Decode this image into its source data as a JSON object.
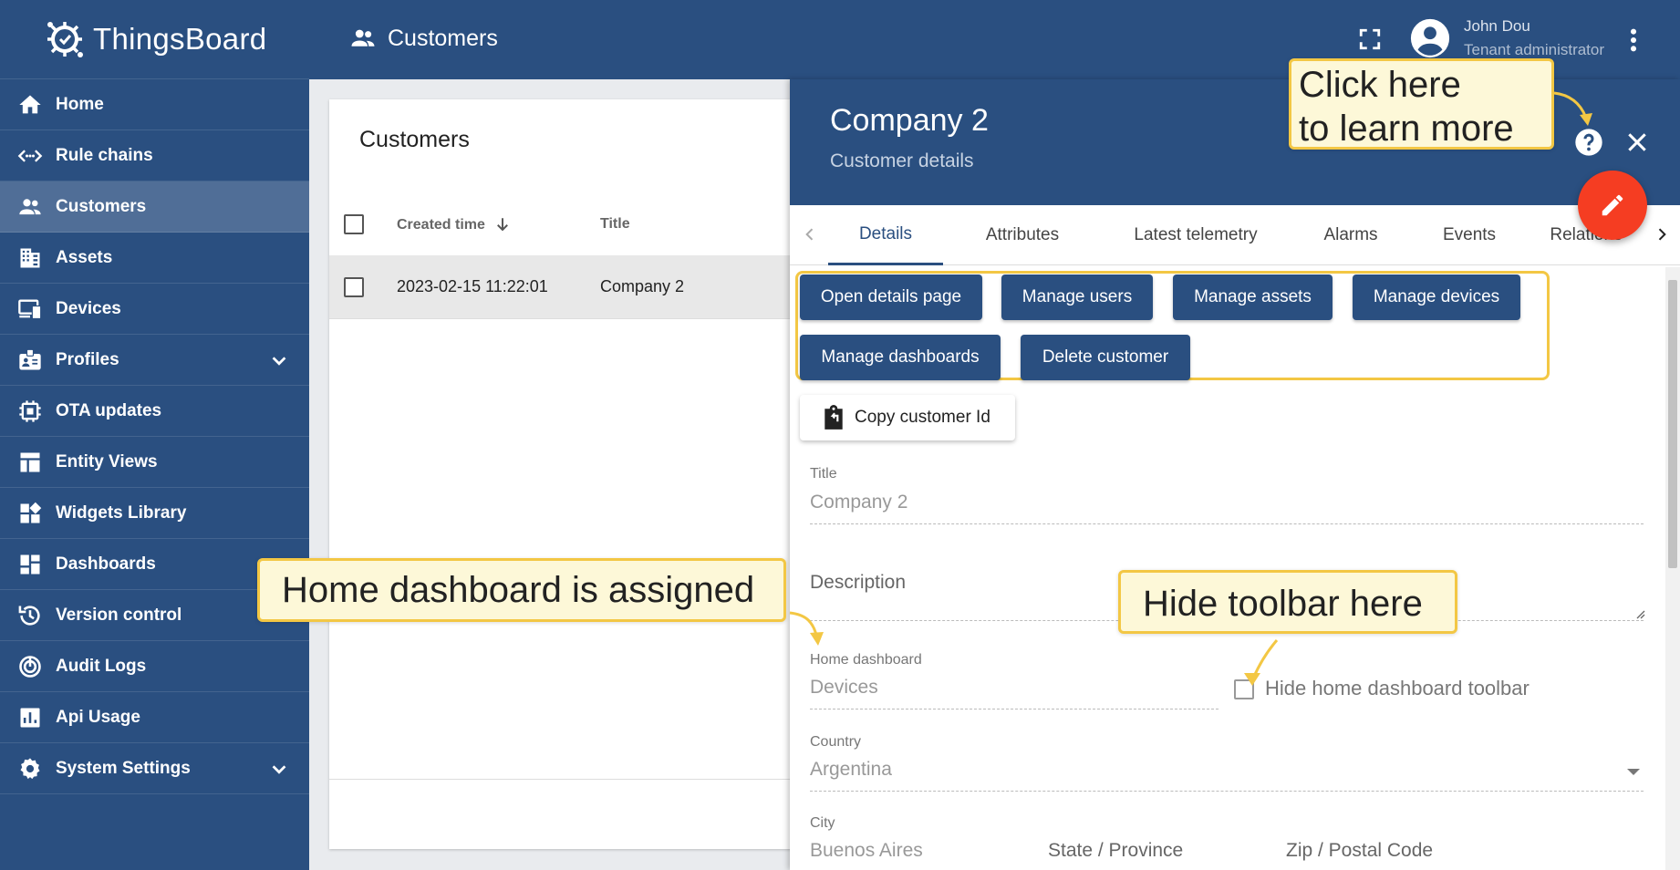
{
  "app": {
    "name": "ThingsBoard"
  },
  "sidebar": {
    "items": [
      {
        "label": "Home",
        "icon": "home-icon"
      },
      {
        "label": "Rule chains",
        "icon": "rule-chains-icon"
      },
      {
        "label": "Customers",
        "icon": "customers-icon",
        "active": true
      },
      {
        "label": "Assets",
        "icon": "assets-icon"
      },
      {
        "label": "Devices",
        "icon": "devices-icon"
      },
      {
        "label": "Profiles",
        "icon": "profiles-icon",
        "expandable": true
      },
      {
        "label": "OTA updates",
        "icon": "ota-updates-icon"
      },
      {
        "label": "Entity Views",
        "icon": "entity-views-icon"
      },
      {
        "label": "Widgets Library",
        "icon": "widgets-library-icon"
      },
      {
        "label": "Dashboards",
        "icon": "dashboards-icon"
      },
      {
        "label": "Version control",
        "icon": "version-control-icon"
      },
      {
        "label": "Audit Logs",
        "icon": "audit-logs-icon"
      },
      {
        "label": "Api Usage",
        "icon": "api-usage-icon"
      },
      {
        "label": "System Settings",
        "icon": "system-settings-icon",
        "expandable": true
      }
    ]
  },
  "topbar": {
    "title": "Customers",
    "user": {
      "name": "John Dou",
      "role": "Tenant administrator"
    }
  },
  "list": {
    "title": "Customers",
    "columns": {
      "created_time": "Created time",
      "title": "Title"
    },
    "rows": [
      {
        "created_time": "2023-02-15 11:22:01",
        "title": "Company 2"
      }
    ]
  },
  "details": {
    "title": "Company 2",
    "subtitle": "Customer details",
    "tabs": [
      "Details",
      "Attributes",
      "Latest telemetry",
      "Alarms",
      "Events",
      "Relations"
    ],
    "active_tab": "Details",
    "buttons": {
      "open_details": "Open details page",
      "manage_users": "Manage users",
      "manage_assets": "Manage assets",
      "manage_devices": "Manage devices",
      "manage_dashboards": "Manage dashboards",
      "delete_customer": "Delete customer",
      "copy_id": "Copy customer Id"
    },
    "fields": {
      "title_label": "Title",
      "title_value": "Company 2",
      "description_label": "Description",
      "home_dashboard_label": "Home dashboard",
      "home_dashboard_value": "Devices",
      "hide_toolbar_label": "Hide home dashboard toolbar",
      "country_label": "Country",
      "country_value": "Argentina",
      "city_label": "City",
      "city_value": "Buenos Aires",
      "state_placeholder": "State / Province",
      "zip_placeholder": "Zip / Postal Code"
    }
  },
  "callouts": {
    "learn_more_line1": "Click here",
    "learn_more_line2": "to learn more",
    "home_dashboard": "Home dashboard is assigned",
    "hide_toolbar": "Hide toolbar here"
  },
  "colors": {
    "primary": "#2a4f80",
    "accent": "#f53d22",
    "callout_border": "#f3c744",
    "callout_bg": "#fdf8d8"
  }
}
